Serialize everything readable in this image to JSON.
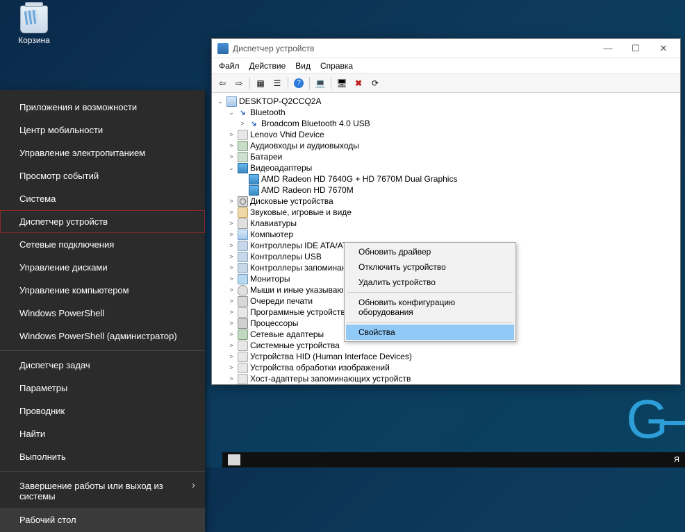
{
  "desktop": {
    "recycle_bin_label": "Корзина"
  },
  "winx": {
    "items_a": [
      "Приложения и возможности",
      "Центр мобильности",
      "Управление электропитанием",
      "Просмотр событий",
      "Система",
      "Диспетчер устройств",
      "Сетевые подключения",
      "Управление дисками",
      "Управление компьютером",
      "Windows PowerShell",
      "Windows PowerShell (администратор)"
    ],
    "items_b": [
      "Диспетчер задач",
      "Параметры",
      "Проводник",
      "Найти",
      "Выполнить"
    ],
    "items_c": [
      "Завершение работы или выход из системы"
    ],
    "footer": "Рабочий стол",
    "highlighted_index": 5
  },
  "devmgr": {
    "title": "Диспетчер устройств",
    "menubar": [
      "Файл",
      "Действие",
      "Вид",
      "Справка"
    ],
    "root": "DESKTOP-Q2CCQ2A",
    "tree": [
      {
        "label": "Bluetooth",
        "icon": "bt",
        "expanded": true,
        "indent": 1,
        "children": [
          {
            "label": "Broadcom Bluetooth 4.0 USB",
            "icon": "bt",
            "indent": 2,
            "has_children": true,
            "collapsed": true
          }
        ]
      },
      {
        "label": "Lenovo Vhid Device",
        "icon": "gen",
        "indent": 1,
        "collapsed": true,
        "has_children": true
      },
      {
        "label": "Аудиовходы и аудиовыходы",
        "icon": "aud",
        "indent": 1,
        "collapsed": true,
        "has_children": true
      },
      {
        "label": "Батареи",
        "icon": "bat",
        "indent": 1,
        "collapsed": true,
        "has_children": true
      },
      {
        "label": "Видеоадаптеры",
        "icon": "disp",
        "expanded": true,
        "indent": 1,
        "children": [
          {
            "label": "AMD Radeon HD 7640G + HD 7670M Dual Graphics",
            "icon": "disp",
            "indent": 2
          },
          {
            "label": "AMD Radeon HD 7670M",
            "icon": "disp",
            "indent": 2
          }
        ]
      },
      {
        "label": "Дисковые устройства",
        "icon": "hdd",
        "indent": 1,
        "collapsed": true,
        "has_children": true
      },
      {
        "label": "Звуковые, игровые и виде",
        "icon": "snd",
        "indent": 1,
        "collapsed": true,
        "has_children": true
      },
      {
        "label": "Клавиатуры",
        "icon": "kbd",
        "indent": 1,
        "collapsed": true,
        "has_children": true
      },
      {
        "label": "Компьютер",
        "icon": "pc",
        "indent": 1,
        "collapsed": true,
        "has_children": true
      },
      {
        "label": "Контроллеры IDE ATA/ATA",
        "icon": "usb",
        "indent": 1,
        "collapsed": true,
        "has_children": true
      },
      {
        "label": "Контроллеры USB",
        "icon": "usb",
        "indent": 1,
        "collapsed": true,
        "has_children": true
      },
      {
        "label": "Контроллеры запоминаю",
        "icon": "usb",
        "indent": 1,
        "collapsed": true,
        "has_children": true
      },
      {
        "label": "Мониторы",
        "icon": "mon",
        "indent": 1,
        "collapsed": true,
        "has_children": true
      },
      {
        "label": "Мыши и иные указывающие устройства",
        "icon": "mse",
        "indent": 1,
        "collapsed": true,
        "has_children": true
      },
      {
        "label": "Очереди печати",
        "icon": "prn",
        "indent": 1,
        "collapsed": true,
        "has_children": true
      },
      {
        "label": "Программные устройства",
        "icon": "gen",
        "indent": 1,
        "collapsed": true,
        "has_children": true
      },
      {
        "label": "Процессоры",
        "icon": "cpu",
        "indent": 1,
        "collapsed": true,
        "has_children": true
      },
      {
        "label": "Сетевые адаптеры",
        "icon": "net",
        "indent": 1,
        "collapsed": true,
        "has_children": true
      },
      {
        "label": "Системные устройства",
        "icon": "gen",
        "indent": 1,
        "collapsed": true,
        "has_children": true
      },
      {
        "label": "Устройства HID (Human Interface Devices)",
        "icon": "gen",
        "indent": 1,
        "collapsed": true,
        "has_children": true
      },
      {
        "label": "Устройства обработки изображений",
        "icon": "gen",
        "indent": 1,
        "collapsed": true,
        "has_children": true
      },
      {
        "label": "Хост-адаптеры запоминающих устройств",
        "icon": "gen",
        "indent": 1,
        "collapsed": true,
        "has_children": true
      }
    ],
    "rcmenu": {
      "items_a": [
        "Обновить драйвер",
        "Отключить устройство",
        "Удалить устройство"
      ],
      "items_b": [
        "Обновить конфигурацию оборудования"
      ],
      "items_c": [
        "Свойства"
      ],
      "highlighted": "Свойства"
    }
  },
  "taskbar": {
    "lang": "Я"
  },
  "watermark": "G"
}
